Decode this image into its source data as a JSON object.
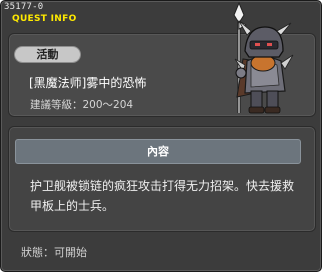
{
  "window": {
    "quest_id": "35177-0",
    "title": "QUEST INFO"
  },
  "quest": {
    "category_tag": "活動",
    "name": "[黑魔法师]雾中的恐怖",
    "level_requirement": "建議等級：200～204",
    "npc_icon": "armored-knight-sprite"
  },
  "content": {
    "header": "內容",
    "body": "护卫舰被锁链的疯狂攻击打得无力招架。快去援救甲板上的士兵。"
  },
  "status": {
    "text": "狀態：可開始"
  },
  "colors": {
    "title_yellow": "#ffea00",
    "window_bg": "#3c3c3c",
    "header_bar": "#6c757d"
  }
}
